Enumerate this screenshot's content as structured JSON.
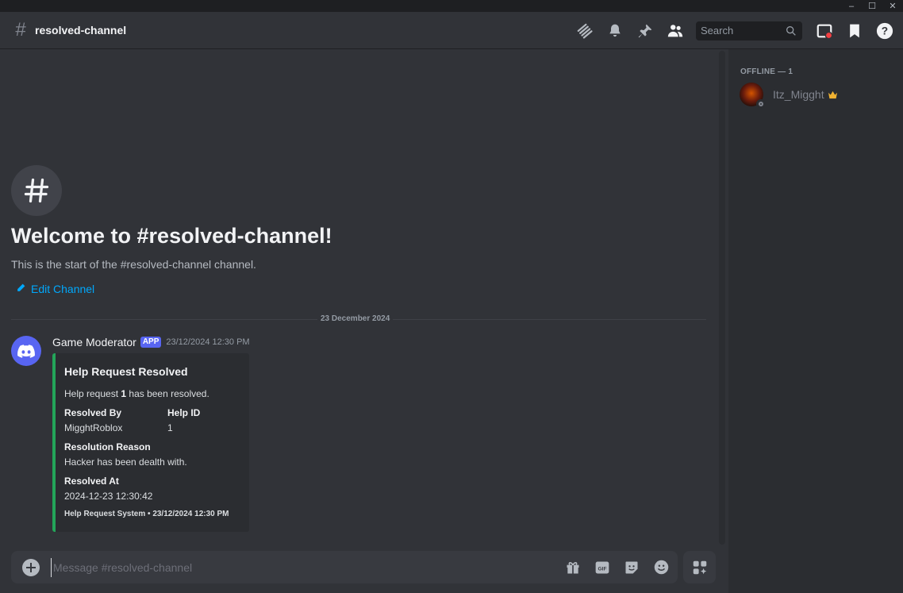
{
  "window": {
    "minimize": "–",
    "maximize": "☐",
    "close": "✕"
  },
  "header": {
    "channel_name": "resolved-channel",
    "search": {
      "placeholder": "Search"
    }
  },
  "welcome": {
    "title": "Welcome to #resolved-channel!",
    "subtitle": "This is the start of the #resolved-channel channel.",
    "edit_label": "Edit Channel"
  },
  "date_divider": "23 December 2024",
  "message": {
    "author": "Game Moderator",
    "badge": "APP",
    "timestamp": "23/12/2024 12:30 PM",
    "embed": {
      "accent": "#23a559",
      "title": "Help Request Resolved",
      "description": {
        "prefix": "Help request ",
        "id": "1",
        "suffix": " has been resolved."
      },
      "fields": [
        {
          "name": "Resolved By",
          "value": "MigghtRoblox"
        },
        {
          "name": "Help ID",
          "value": "1"
        },
        {
          "name": "Resolution Reason",
          "value": "Hacker has been dealth with."
        },
        {
          "name": "Resolved At",
          "value": "2024-12-23 12:30:42"
        }
      ],
      "footer": "Help Request System • 23/12/2024 12:30 PM"
    }
  },
  "composer": {
    "placeholder": "Message #resolved-channel",
    "gif_label": "GIF"
  },
  "members": {
    "section_label": "OFFLINE — 1",
    "list": [
      {
        "name": "Itz_Migght",
        "status": "offline",
        "owner": true
      }
    ]
  },
  "colors": {
    "brand": "#5865f2",
    "link": "#00a8fc",
    "owner_crown": "#f0b232"
  }
}
